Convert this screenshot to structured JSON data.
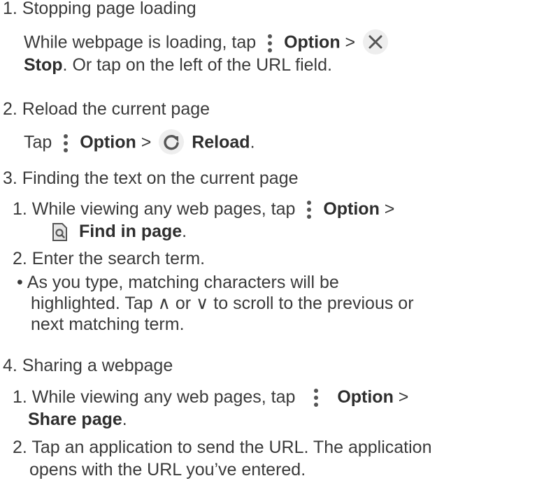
{
  "s1": {
    "heading": "1. Stopping page loading",
    "p1_text": "While webpage is loading, tap",
    "p1_option": "Option",
    "p1_gt": ">",
    "p2_stop": "Stop",
    "p2_rest": ". Or tap on the left of the URL field."
  },
  "s2": {
    "heading": "2. Reload the current page",
    "tap": "Tap",
    "option": "Option",
    "gt": ">",
    "reload": "Reload",
    "period": "."
  },
  "s3": {
    "heading": "3. Finding the text on the current page",
    "step1_text": "1. While viewing any web pages, tap",
    "step1_option": "Option",
    "step1_gt": ">",
    "step1_find": "Find in page",
    "step1_period": ".",
    "step2": "2. Enter the search term.",
    "bullet": "•",
    "bullet_l1": "As you type, matching characters will be",
    "bullet_l2": "highlighted. Tap ∧ or ∨ to scroll to the previous or",
    "bullet_l3": "next matching term."
  },
  "s4": {
    "heading": "4. Sharing a webpage",
    "step1_text": "1. While viewing any web pages, tap",
    "step1_option": "Option",
    "step1_gt": ">",
    "step1_share": "Share page",
    "step1_period": ".",
    "step2_l1": "2. Tap an application to send the URL. The application",
    "step2_l2": "opens with the URL you’ve entered."
  },
  "icons": [
    "more-vert-icon",
    "close-icon",
    "refresh-icon",
    "find-in-page-icon"
  ],
  "colors": {
    "text": "#3a3a3a",
    "icon": "#555555",
    "icon_circle_bg": "#eeeeee"
  }
}
